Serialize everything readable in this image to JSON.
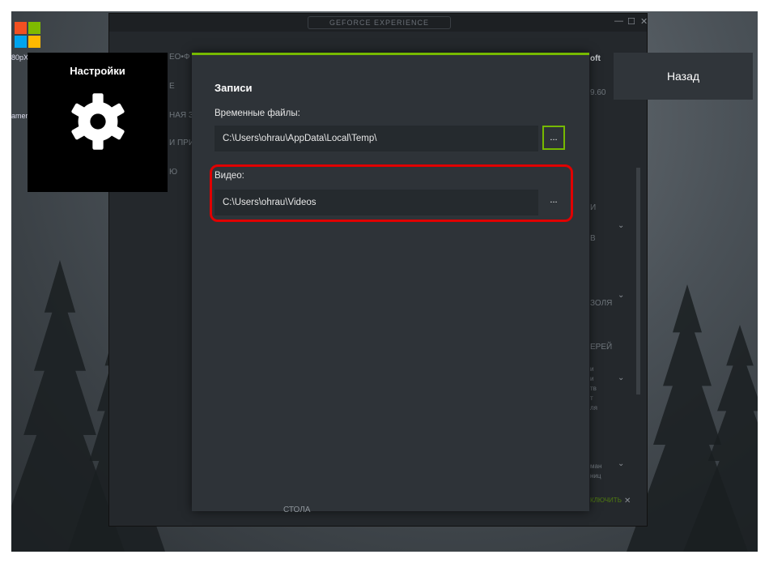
{
  "desktop": {
    "top_left_text": "80pX",
    "left_text": "amer"
  },
  "app": {
    "title": "GEFORCE EXPERIENCE",
    "window_controls": {
      "minimize": "—",
      "maximize": "☐",
      "close": "✕"
    },
    "faded_left": [
      "ЕО•Ф",
      "Е",
      "НАЯ ЗА",
      "И ПРИ",
      "Ю"
    ],
    "faded_right": [
      "oft",
      "9.60",
      "И",
      "В",
      "ЗОЛЯ",
      "ЕРЕЙ",
      "и",
      "и",
      "тв",
      "т",
      "ля",
      "ман",
      "ниц",
      "КЛЮЧИТЬ"
    ],
    "bottom_text": "СТОЛА"
  },
  "settings_tile": {
    "title": "Настройки",
    "icon": "gear-icon"
  },
  "back_button": {
    "label": "Назад"
  },
  "modal": {
    "section_title": "Записи",
    "temp_files": {
      "label": "Временные файлы:",
      "path": "C:\\Users\\ohrau\\AppData\\Local\\Temp\\",
      "browse_label": "..."
    },
    "video": {
      "label": "Видео:",
      "path": "C:\\Users\\ohrau\\Videos",
      "browse_label": "..."
    }
  },
  "colors": {
    "accent": "#76b900",
    "highlight": "#e00000",
    "modal_bg": "#2e3338",
    "tile_bg": "#000000"
  }
}
